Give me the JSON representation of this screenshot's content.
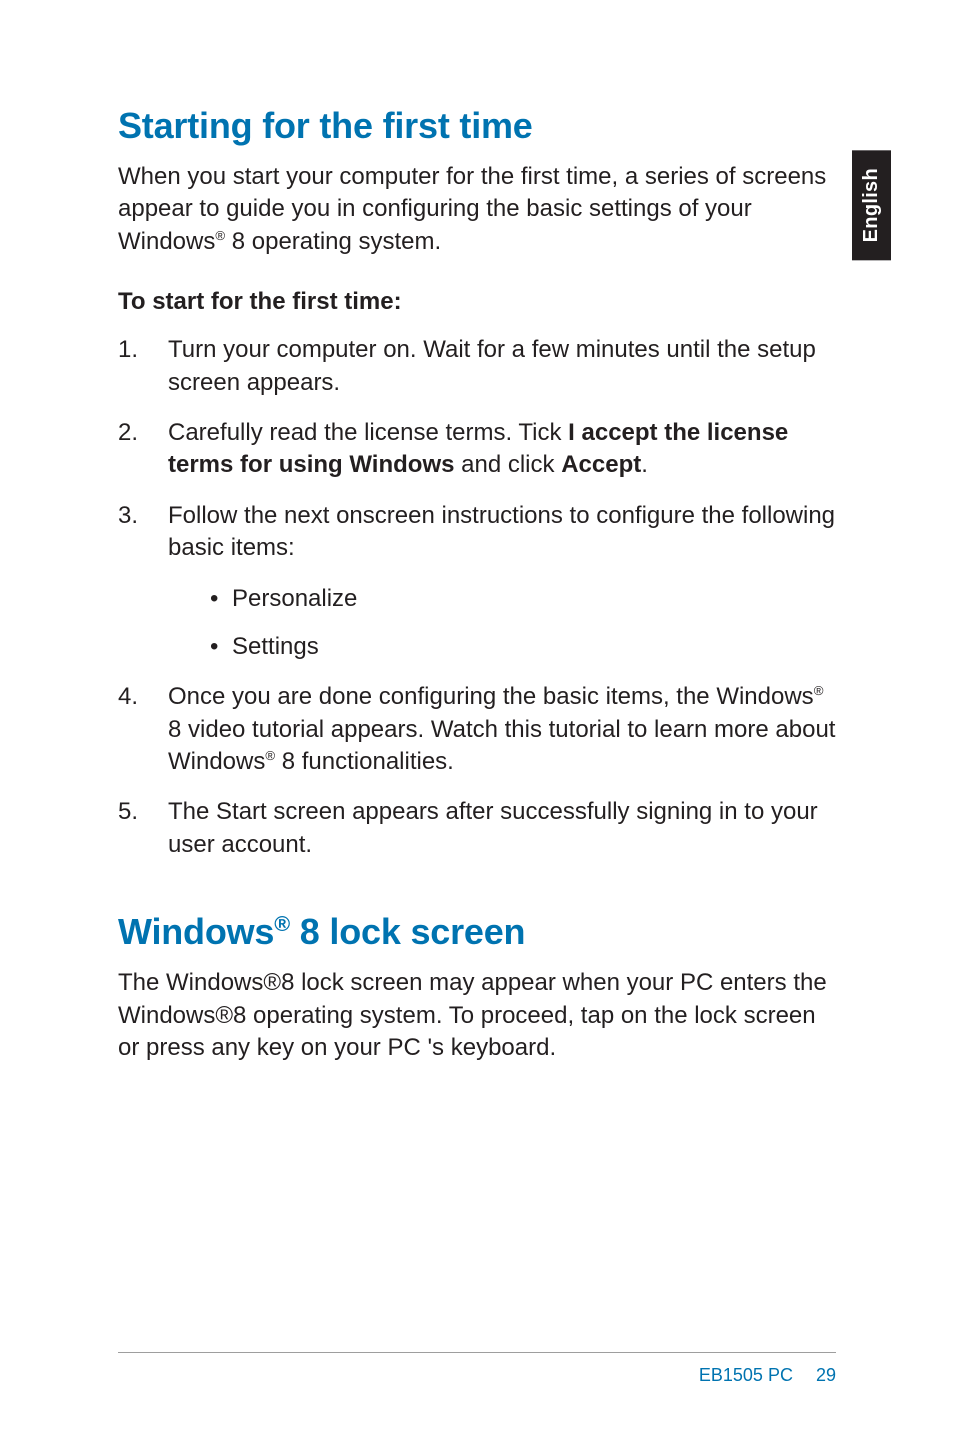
{
  "side_tab": "English",
  "heading1": {
    "text": "Starting for the first time"
  },
  "intro1": {
    "prefix": "When you start your computer for the first time, a series of screens appear to guide you in configuring the basic settings of your Windows",
    "sup": "®",
    "suffix": " 8 operating system."
  },
  "subhead": "To start for the first time:",
  "steps": {
    "s1": {
      "num": "1.",
      "text": "Turn your computer on. Wait for a few minutes until the setup screen appears."
    },
    "s2": {
      "num": "2.",
      "pre": "Carefully read the license terms. Tick ",
      "bold1": "I accept the license terms for using Windows",
      "mid": " and click ",
      "bold2": "Accept",
      "post": "."
    },
    "s3": {
      "num": "3.",
      "text": "Follow the next onscreen instructions to configure the following basic items:",
      "bullets": {
        "b1": "Personalize",
        "b2": "Settings"
      }
    },
    "s4": {
      "num": "4.",
      "pre": "Once you are done configuring the basic items, the Windows",
      "sup1": "®",
      "mid": " 8 video tutorial appears. Watch this tutorial to learn more about Windows",
      "sup2": "®",
      "post": " 8 functionalities."
    },
    "s5": {
      "num": "5.",
      "text": "The Start screen appears after  successfully signing in to your user account."
    }
  },
  "heading2": {
    "pre": "Windows",
    "sup": "®",
    "post": " 8 lock screen"
  },
  "intro2": "The Windows®8 lock screen may appear when your PC enters the Windows®8 operating system. To proceed,  tap on the lock screen or press any key on your PC 's keyboard.",
  "footer": {
    "product": "EB1505 PC",
    "page": "29"
  }
}
